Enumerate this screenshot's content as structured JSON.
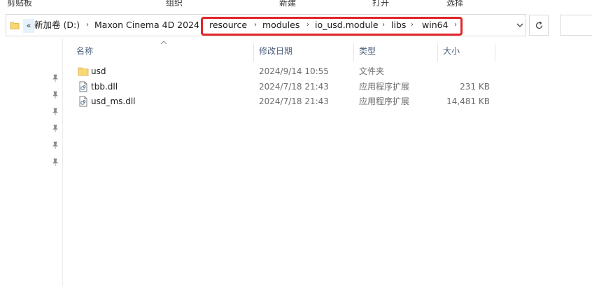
{
  "ribbon": {
    "groups": [
      "剪贴板",
      "组织",
      "新建",
      "打开",
      "选择"
    ]
  },
  "address_bar": {
    "overflow_label": "«",
    "crumbs": [
      "新加卷 (D:)",
      "Maxon Cinema 4D 2024",
      "resource",
      "modules",
      "io_usd.module",
      "libs",
      "win64"
    ],
    "separator": "›",
    "highlight_color": "#e0262b"
  },
  "columns": {
    "name": "名称",
    "modified": "修改日期",
    "type": "类型",
    "size": "大小"
  },
  "files": [
    {
      "name": "usd",
      "modified": "2024/9/14 10:55",
      "type": "文件夹",
      "size": "",
      "icon": "folder-icon"
    },
    {
      "name": "tbb.dll",
      "modified": "2024/7/18 21:43",
      "type": "应用程序扩展",
      "size": "231 KB",
      "icon": "dll-file-icon"
    },
    {
      "name": "usd_ms.dll",
      "modified": "2024/7/18 21:43",
      "type": "应用程序扩展",
      "size": "14,481 KB",
      "icon": "dll-file-icon"
    }
  ],
  "nav_pane": {
    "pinned_count": 6
  },
  "colors": {
    "folder": "#f8d775",
    "header_text": "#4c607a",
    "accent_hover": "#e5f1fb"
  }
}
